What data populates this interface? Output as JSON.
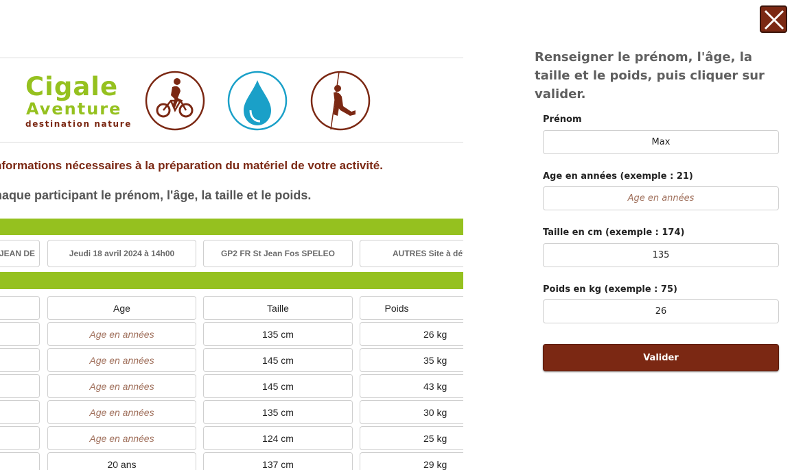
{
  "brand": {
    "name_line1": "Cigale",
    "name_line2": "Aventure",
    "tagline": "destination nature",
    "green": "#95c11f",
    "brown": "#7b2813",
    "blue": "#1aa0c8"
  },
  "activities": [
    {
      "icon": "cyclist-icon"
    },
    {
      "icon": "water-drop-icon"
    },
    {
      "icon": "climber-icon"
    }
  ],
  "intro": {
    "title": "nformations nécessaires à la préparation du matériel de votre activité.",
    "subtitle": "haque participant le prénom, l'âge, la taille et le poids."
  },
  "booking_info": {
    "col0": "JEAN DE",
    "date": "Jeudi 18 avril 2024 à 14h00",
    "product": "GP2 FR St Jean Fos SPELEO",
    "site": "AUTRES Site à défi"
  },
  "table": {
    "headers": [
      "Age",
      "Taille",
      "Poids"
    ],
    "age_placeholder": "Age en années",
    "rows": [
      {
        "age": "",
        "taille": "135 cm",
        "poids": "26 kg"
      },
      {
        "age": "",
        "taille": "145 cm",
        "poids": "35 kg"
      },
      {
        "age": "",
        "taille": "145 cm",
        "poids": "43 kg"
      },
      {
        "age": "",
        "taille": "135 cm",
        "poids": "30 kg"
      },
      {
        "age": "",
        "taille": "124 cm",
        "poids": "25 kg"
      },
      {
        "age": "20 ans",
        "taille": "137 cm",
        "poids": "29 kg"
      }
    ]
  },
  "panel": {
    "instructions": "Renseigner le prénom, l'âge, la taille et le poids, puis cliquer sur valider.",
    "fields": {
      "prenom": {
        "label": "Prénom",
        "value": "Max",
        "placeholder": ""
      },
      "age": {
        "label": "Age en années (exemple : 21)",
        "value": "",
        "placeholder": "Age en années"
      },
      "taille": {
        "label": "Taille en cm (exemple : 174)",
        "value": "135",
        "placeholder": ""
      },
      "poids": {
        "label": "Poids en kg (exemple : 75)",
        "value": "26",
        "placeholder": ""
      }
    },
    "submit_label": "Valider",
    "close_icon": "close-icon"
  }
}
